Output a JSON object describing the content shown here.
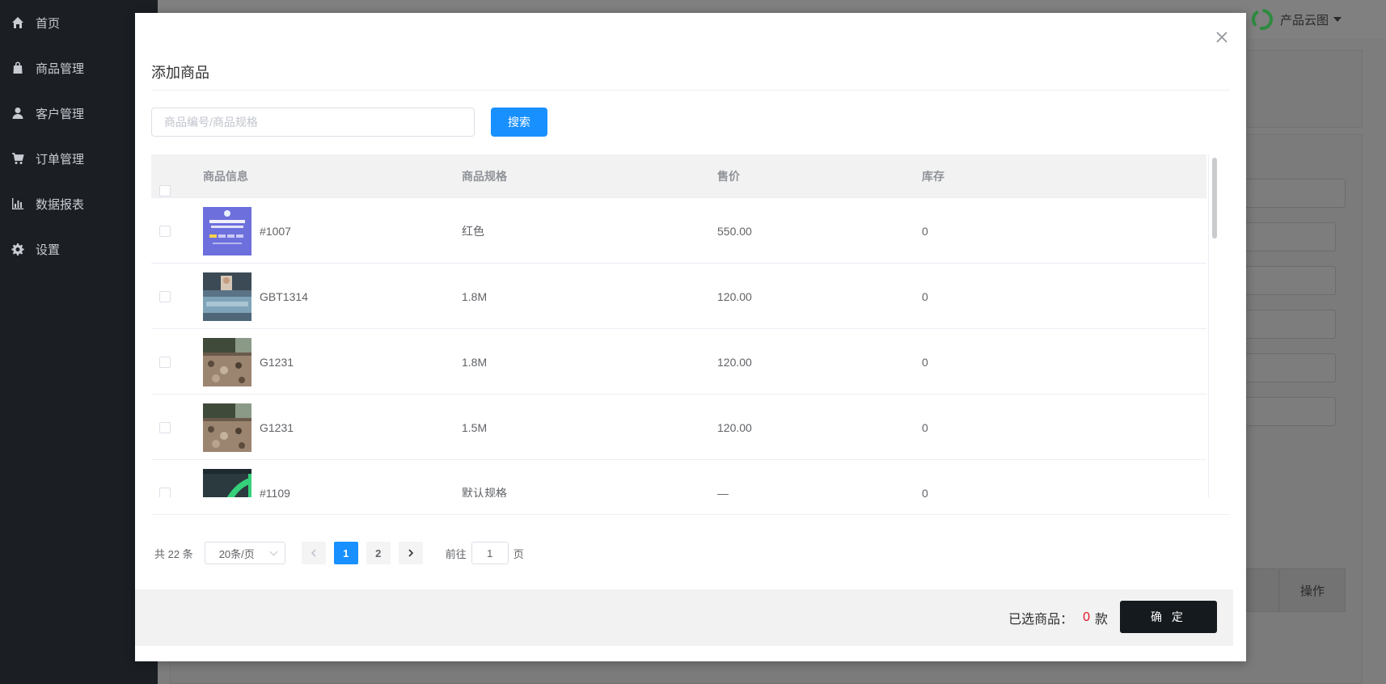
{
  "sidebar": {
    "items": [
      {
        "label": "首页",
        "icon": "home-icon"
      },
      {
        "label": "商品管理",
        "icon": "bag-icon"
      },
      {
        "label": "客户管理",
        "icon": "user-icon"
      },
      {
        "label": "订单管理",
        "icon": "cart-icon"
      },
      {
        "label": "数据报表",
        "icon": "chart-icon"
      },
      {
        "label": "设置",
        "icon": "gear-icon"
      }
    ]
  },
  "header": {
    "user_label": "产品云图"
  },
  "background": {
    "table_header_action": "操作"
  },
  "dialog": {
    "title": "添加商品",
    "search": {
      "placeholder": "商品编号/商品规格",
      "value": "",
      "button_label": "搜索"
    },
    "table": {
      "columns": [
        "商品信息",
        "商品规格",
        "售价",
        "库存"
      ],
      "rows": [
        {
          "code": "#1007",
          "spec": "红色",
          "price": "550.00",
          "stock": "0",
          "thumb": "promo-banner"
        },
        {
          "code": "GBT1314",
          "spec": "1.8M",
          "price": "120.00",
          "stock": "0",
          "thumb": "bedroom-photo"
        },
        {
          "code": "G1231",
          "spec": "1.8M",
          "price": "120.00",
          "stock": "0",
          "thumb": "bedding-photo"
        },
        {
          "code": "G1231",
          "spec": "1.5M",
          "price": "120.00",
          "stock": "0",
          "thumb": "bedding-photo"
        },
        {
          "code": "#1109",
          "spec": "默认规格",
          "price": "—",
          "stock": "0",
          "thumb": "dark-graphic"
        }
      ]
    },
    "pagination": {
      "total": "共 22 条",
      "page_size": "20条/页",
      "pages": [
        "1",
        "2"
      ],
      "current": "1",
      "goto_prefix": "前往",
      "goto_value": "1",
      "goto_suffix": "页"
    },
    "footer": {
      "selected_label": "已选商品：",
      "selected_count": "0",
      "selected_unit": "款",
      "confirm_label": "确 定"
    }
  },
  "colors": {
    "primary": "#1890ff",
    "confirm": "#141a1d",
    "count": "#e6142a",
    "sidebar": "#1b1f24"
  }
}
